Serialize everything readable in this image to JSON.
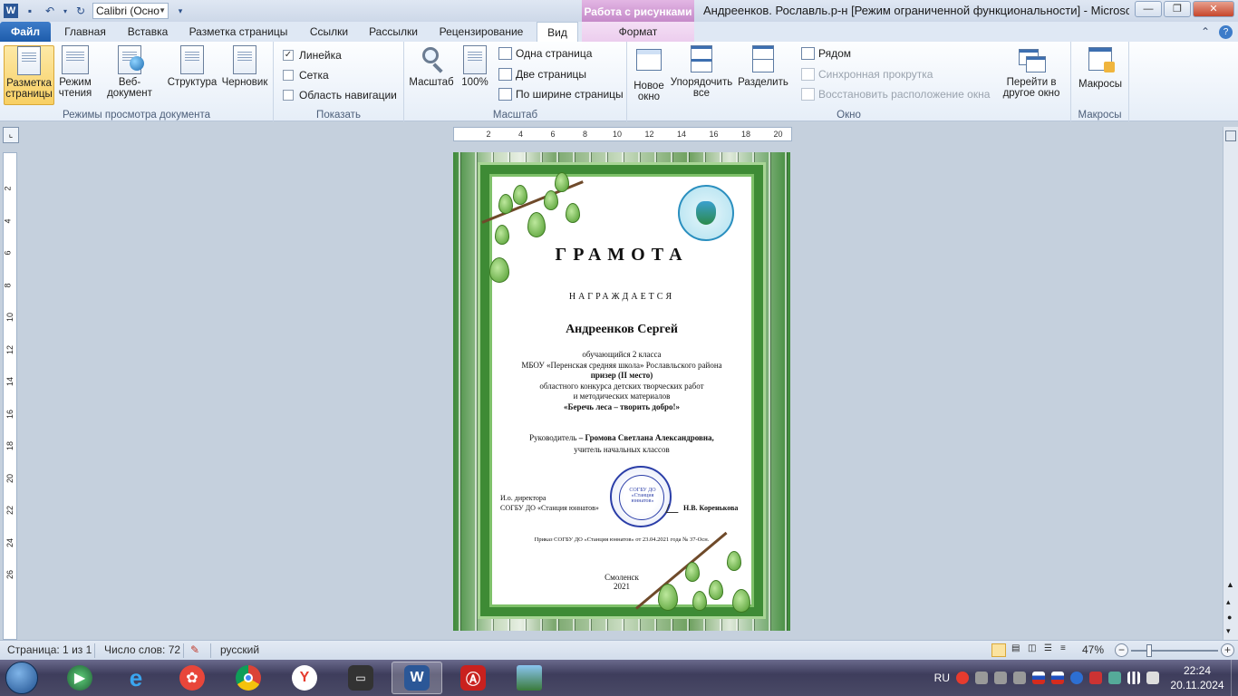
{
  "titlebar": {
    "font_name": "Calibri (Осно",
    "context_group": "Работа с рисунками",
    "window_title": "Андреенков. Рославль.р-н [Режим ограниченной функциональности]  -  Microsoft ..."
  },
  "tabs": {
    "file": "Файл",
    "items": [
      "Главная",
      "Вставка",
      "Разметка страницы",
      "Ссылки",
      "Рассылки",
      "Рецензирование",
      "Вид",
      "Формат"
    ],
    "active": "Вид"
  },
  "ribbon": {
    "views": {
      "label": "Режимы просмотра документа",
      "print_layout": [
        "Разметка",
        "страницы"
      ],
      "reading": [
        "Режим",
        "чтения"
      ],
      "web": "Веб-документ",
      "outline": "Структура",
      "draft": "Черновик"
    },
    "show": {
      "label": "Показать",
      "ruler": "Линейка",
      "ruler_checked": true,
      "grid": "Сетка",
      "grid_checked": false,
      "nav_pane": "Область навигации",
      "nav_checked": false
    },
    "zoom": {
      "label": "Масштаб",
      "zoom_btn": "Масштаб",
      "hundred": "100%",
      "one_page": "Одна страница",
      "two_pages": "Две страницы",
      "page_width": "По ширине страницы"
    },
    "window": {
      "label": "Окно",
      "new_window": [
        "Новое",
        "окно"
      ],
      "arrange_all": [
        "Упорядочить",
        "все"
      ],
      "split": "Разделить",
      "side_by_side": "Рядом",
      "sync_scroll": "Синхронная прокрутка",
      "reset_pos": "Восстановить расположение окна",
      "switch": [
        "Перейти в",
        "другое окно"
      ]
    },
    "macros": {
      "label": "Макросы",
      "macros_btn": "Макросы"
    }
  },
  "ruler": {
    "h_ticks": [
      "2",
      "4",
      "6",
      "8",
      "10",
      "12",
      "14",
      "16",
      "18",
      "20"
    ],
    "v_ticks": [
      "2",
      "4",
      "6",
      "8",
      "10",
      "12",
      "14",
      "16",
      "18",
      "20",
      "22",
      "24",
      "26"
    ]
  },
  "certificate": {
    "title": "ГРАМОТА",
    "award": "НАГРАЖДАЕТСЯ",
    "name": "Андреенков Сергей",
    "line1": "обучающийся 2 класса",
    "line2": "МБОУ «Перенская  средняя  школа» Рославльского района",
    "line3": "призер (II место)",
    "line4": "областного  конкурса детских  творческих работ",
    "line5": "и методических  материалов",
    "line6": "«Беречь леса – творить добро!»",
    "leader_prefix": "Руководитель",
    "leader_name": "– Громова Светлана Александровна,",
    "leader_role": "учитель начальных  классов",
    "director_title": "И.о. директора",
    "director_org": "СОГБУ ДО «Станция юннатов»",
    "director_name": "Н.В. Коренькова",
    "stamp_text": "СОГБУ ДО «Станция юннатов»",
    "order": "Приказ  СОГБУ ДО «Станция юннатов» от   23.04.2021 года № 37-Осн.",
    "city": "Смоленск",
    "year": "2021"
  },
  "statusbar": {
    "page": "Страница: 1 из 1",
    "words": "Число слов: 72",
    "language": "русский",
    "zoom": "47%",
    "zoom_level_percent": 47
  },
  "taskbar": {
    "language": "RU",
    "time": "22:24",
    "date": "20.11.2024",
    "apps": [
      "start",
      "media-player",
      "internet-explorer",
      "photo-app",
      "chrome",
      "yandex-browser",
      "printer",
      "word",
      "pdf-reader",
      "image-viewer"
    ]
  },
  "colors": {
    "file_tab": "#2b6cbf",
    "context_tab": "#c58ac9",
    "frame_green": "#3e8b35"
  }
}
